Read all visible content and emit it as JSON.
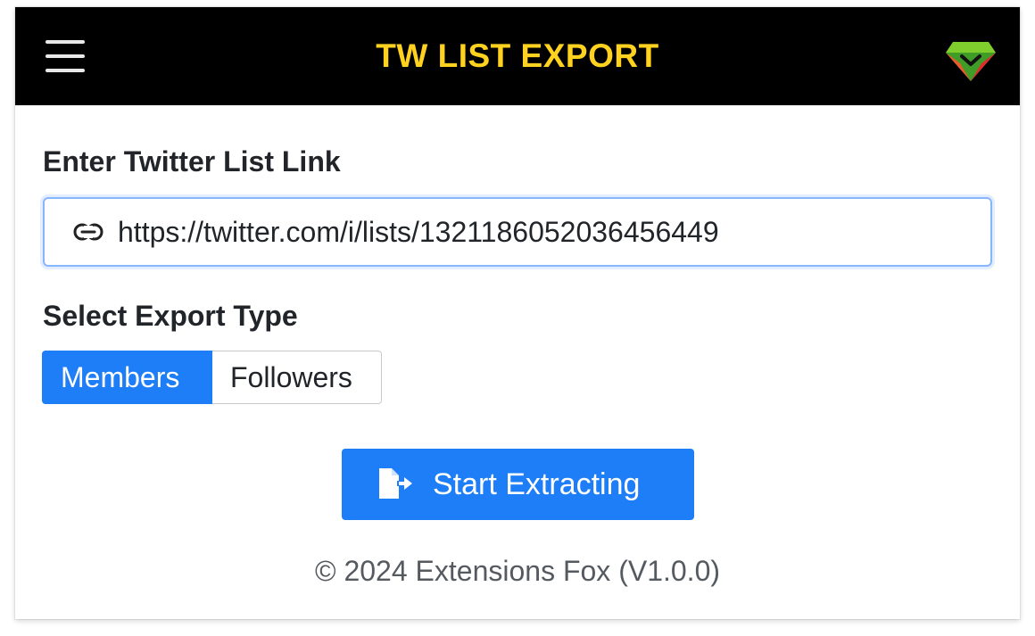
{
  "app": {
    "title": "TW LIST EXPORT",
    "header_bg": "#000000",
    "title_color": "#ffd21f"
  },
  "icons": {
    "menu": "hamburger-menu-icon",
    "logo": "gem-logo-icon",
    "link": "link-chain-icon",
    "export": "file-export-icon"
  },
  "link_section": {
    "label": "Enter Twitter List Link",
    "input_value": "https://twitter.com/i/lists/1321186052036456449"
  },
  "export_type": {
    "label": "Select Export Type",
    "options": [
      "Members",
      "Followers"
    ],
    "selected": "Members"
  },
  "actions": {
    "start_label": "Start Extracting",
    "accent": "#1e7ef8"
  },
  "footer": {
    "text": "© 2024 Extensions Fox (V1.0.0)"
  }
}
